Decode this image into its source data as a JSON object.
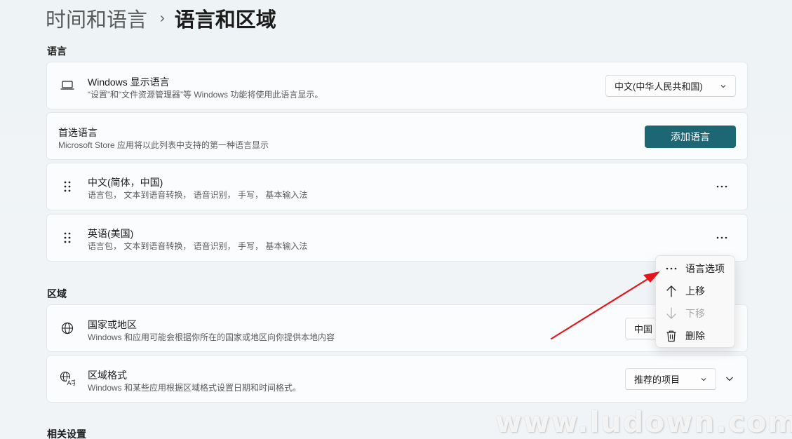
{
  "breadcrumb": {
    "parent": "时间和语言",
    "separator": "›",
    "current": "语言和区域"
  },
  "sections": {
    "language": "语言",
    "region": "区域",
    "related": "相关设置"
  },
  "display_language": {
    "icon": "laptop-icon",
    "title": "Windows 显示语言",
    "subtitle": "“设置”和“文件资源管理器”等 Windows 功能将使用此语言显示。",
    "value": "中文(中华人民共和国)"
  },
  "preferred_language": {
    "title": "首选语言",
    "subtitle": "Microsoft Store 应用将以此列表中支持的第一种语言显示",
    "add_button": "添加语言"
  },
  "languages": [
    {
      "name": "中文(简体，中国)",
      "features": "语言包， 文本到语音转换， 语音识别， 手写， 基本输入法"
    },
    {
      "name": "英语(美国)",
      "features": "语言包， 文本到语音转换， 语音识别， 手写， 基本输入法"
    }
  ],
  "context_menu": {
    "items": [
      {
        "icon": "more-icon",
        "label": "语言选项",
        "enabled": true
      },
      {
        "icon": "arrow-up-icon",
        "label": "上移",
        "enabled": true
      },
      {
        "icon": "arrow-down-icon",
        "label": "下移",
        "enabled": false
      },
      {
        "icon": "trash-icon",
        "label": "删除",
        "enabled": true
      }
    ]
  },
  "country_region": {
    "icon": "globe-icon",
    "title": "国家或地区",
    "subtitle": "Windows 和应用可能会根据你所在的国家或地区向你提供本地内容",
    "value": "中国"
  },
  "regional_format": {
    "icon": "regional-format-icon",
    "title": "区域格式",
    "subtitle": "Windows 和某些应用根据区域格式设置日期和时间格式。",
    "value": "推荐的项目"
  },
  "annotation_arrow_color": "#e8141b",
  "accent_color": "#1d6674",
  "watermark": "www.ludown.com"
}
